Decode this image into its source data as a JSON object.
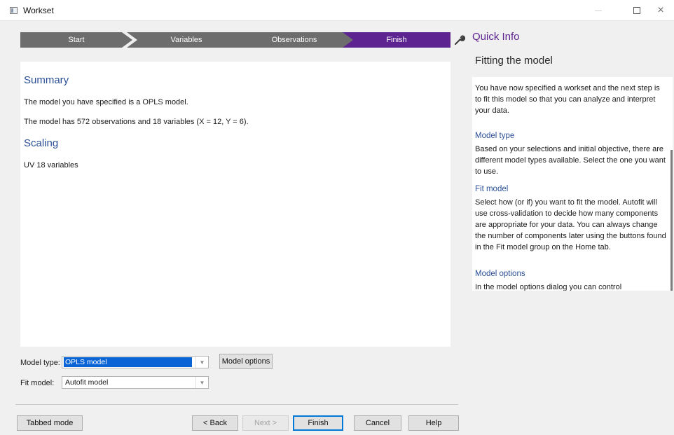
{
  "window": {
    "title": "Workset",
    "close_glyph": "×"
  },
  "steps": [
    {
      "label": "Start"
    },
    {
      "label": "Variables"
    },
    {
      "label": "Observations"
    },
    {
      "label": "Finish",
      "active": true
    }
  ],
  "colors": {
    "active_step": "#5d2391",
    "inactive_step": "#6d6d6d",
    "heading": "#2b4f95",
    "quick_info_title": "#5d2391"
  },
  "summary": {
    "heading": "Summary",
    "line1": "The model you have specified is a OPLS model.",
    "line2": "The model has 572 observations and 18 variables (X = 12, Y = 6).",
    "scaling_heading": "Scaling",
    "scaling_text": "UV 18 variables"
  },
  "model_type": {
    "label": "Model type:",
    "value": "OPLS model"
  },
  "fit_model": {
    "label": "Fit model:",
    "value": "Autofit model"
  },
  "buttons": {
    "model_options": "Model options",
    "tabbed_mode": "Tabbed mode",
    "back": "< Back",
    "next": "Next >",
    "finish": "Finish",
    "cancel": "Cancel",
    "help": "Help"
  },
  "quick_info": {
    "title": "Quick Info",
    "heading": "Fitting the model",
    "more_glyph": "⋮",
    "intro": "You have now specified a workset and the next step is to fit this model so that you can analyze and interpret your data.",
    "sections": [
      {
        "heading": "Model type",
        "text": "Based on your selections and initial objective, there are different model types available. Select the one you want to use."
      },
      {
        "heading": "Fit model",
        "text": "Select how (or if) you want to fit the model. Autofit will use cross-validation to decide how many components are appropriate for your data. You can always change the number of components later using the buttons found in the Fit model group on the Home tab."
      },
      {
        "heading": "Model options",
        "text": "In the model options dialog you can control"
      }
    ]
  },
  "icons": {
    "app": "workset-app-icon",
    "wrench": "wrench-icon",
    "dropdown": "chevron-down-icon"
  }
}
